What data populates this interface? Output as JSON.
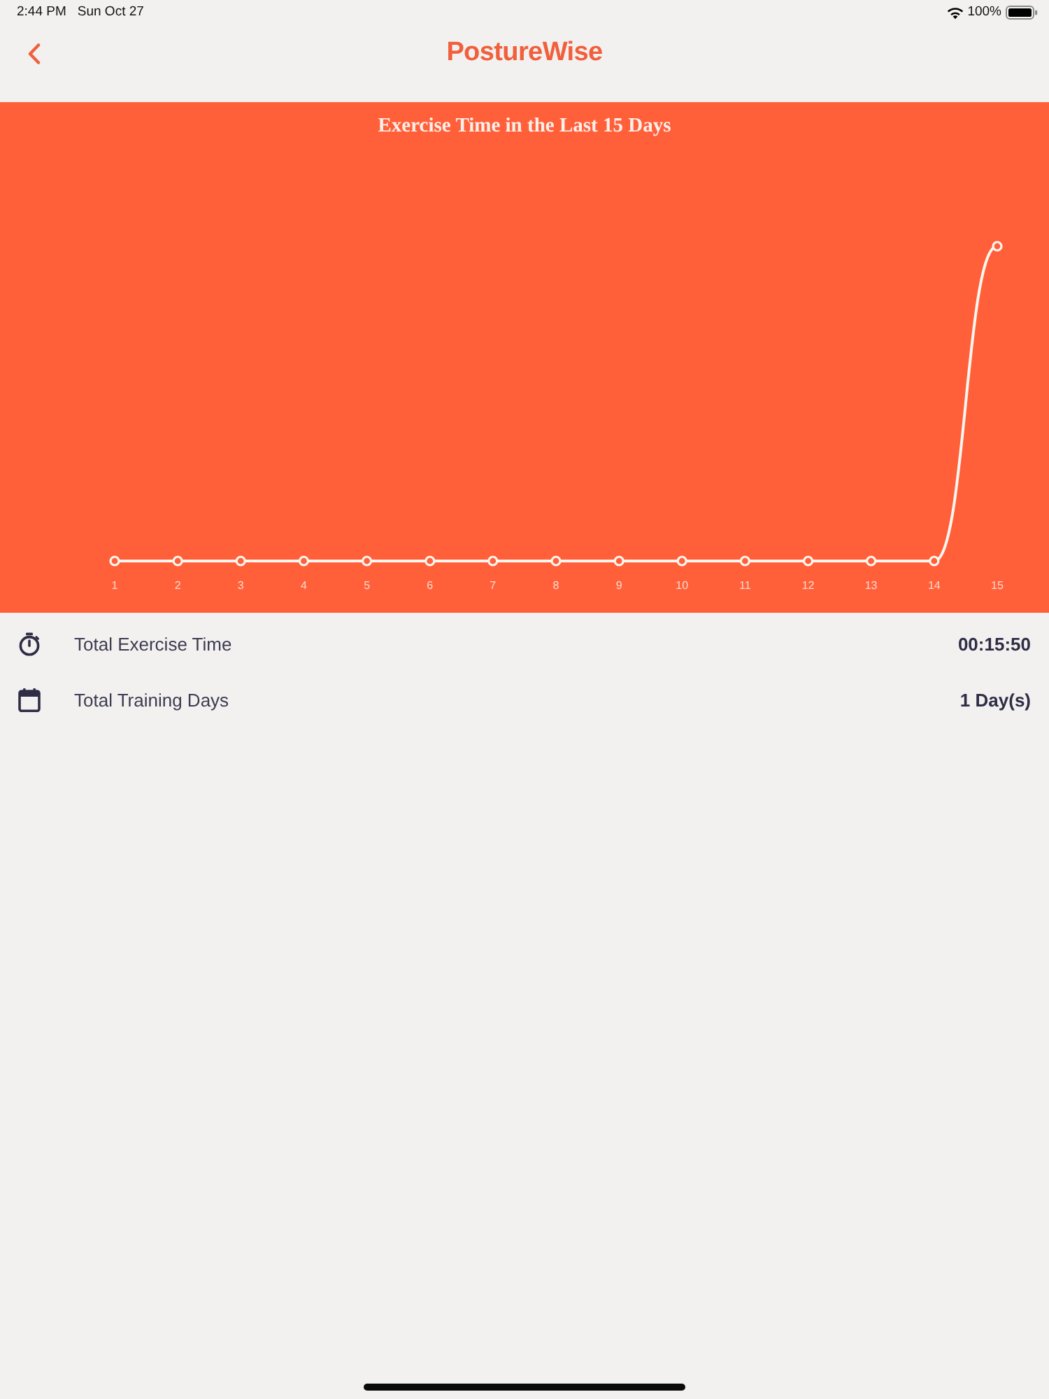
{
  "status_bar": {
    "time": "2:44 PM",
    "date": "Sun Oct 27",
    "battery": "100%"
  },
  "nav_bar": {
    "title": "PostureWise"
  },
  "chart": {
    "title": "Exercise Time in the Last 15 Days",
    "x_labels": [
      "1",
      "2",
      "3",
      "4",
      "5",
      "6",
      "7",
      "8",
      "9",
      "10",
      "11",
      "12",
      "13",
      "14",
      "15"
    ]
  },
  "stats": [
    {
      "kind": "timer",
      "label": "Total Exercise Time",
      "value": "00:15:50"
    },
    {
      "kind": "calendar",
      "label": "Total Training Days",
      "value": "1 Day(s)"
    }
  ]
}
